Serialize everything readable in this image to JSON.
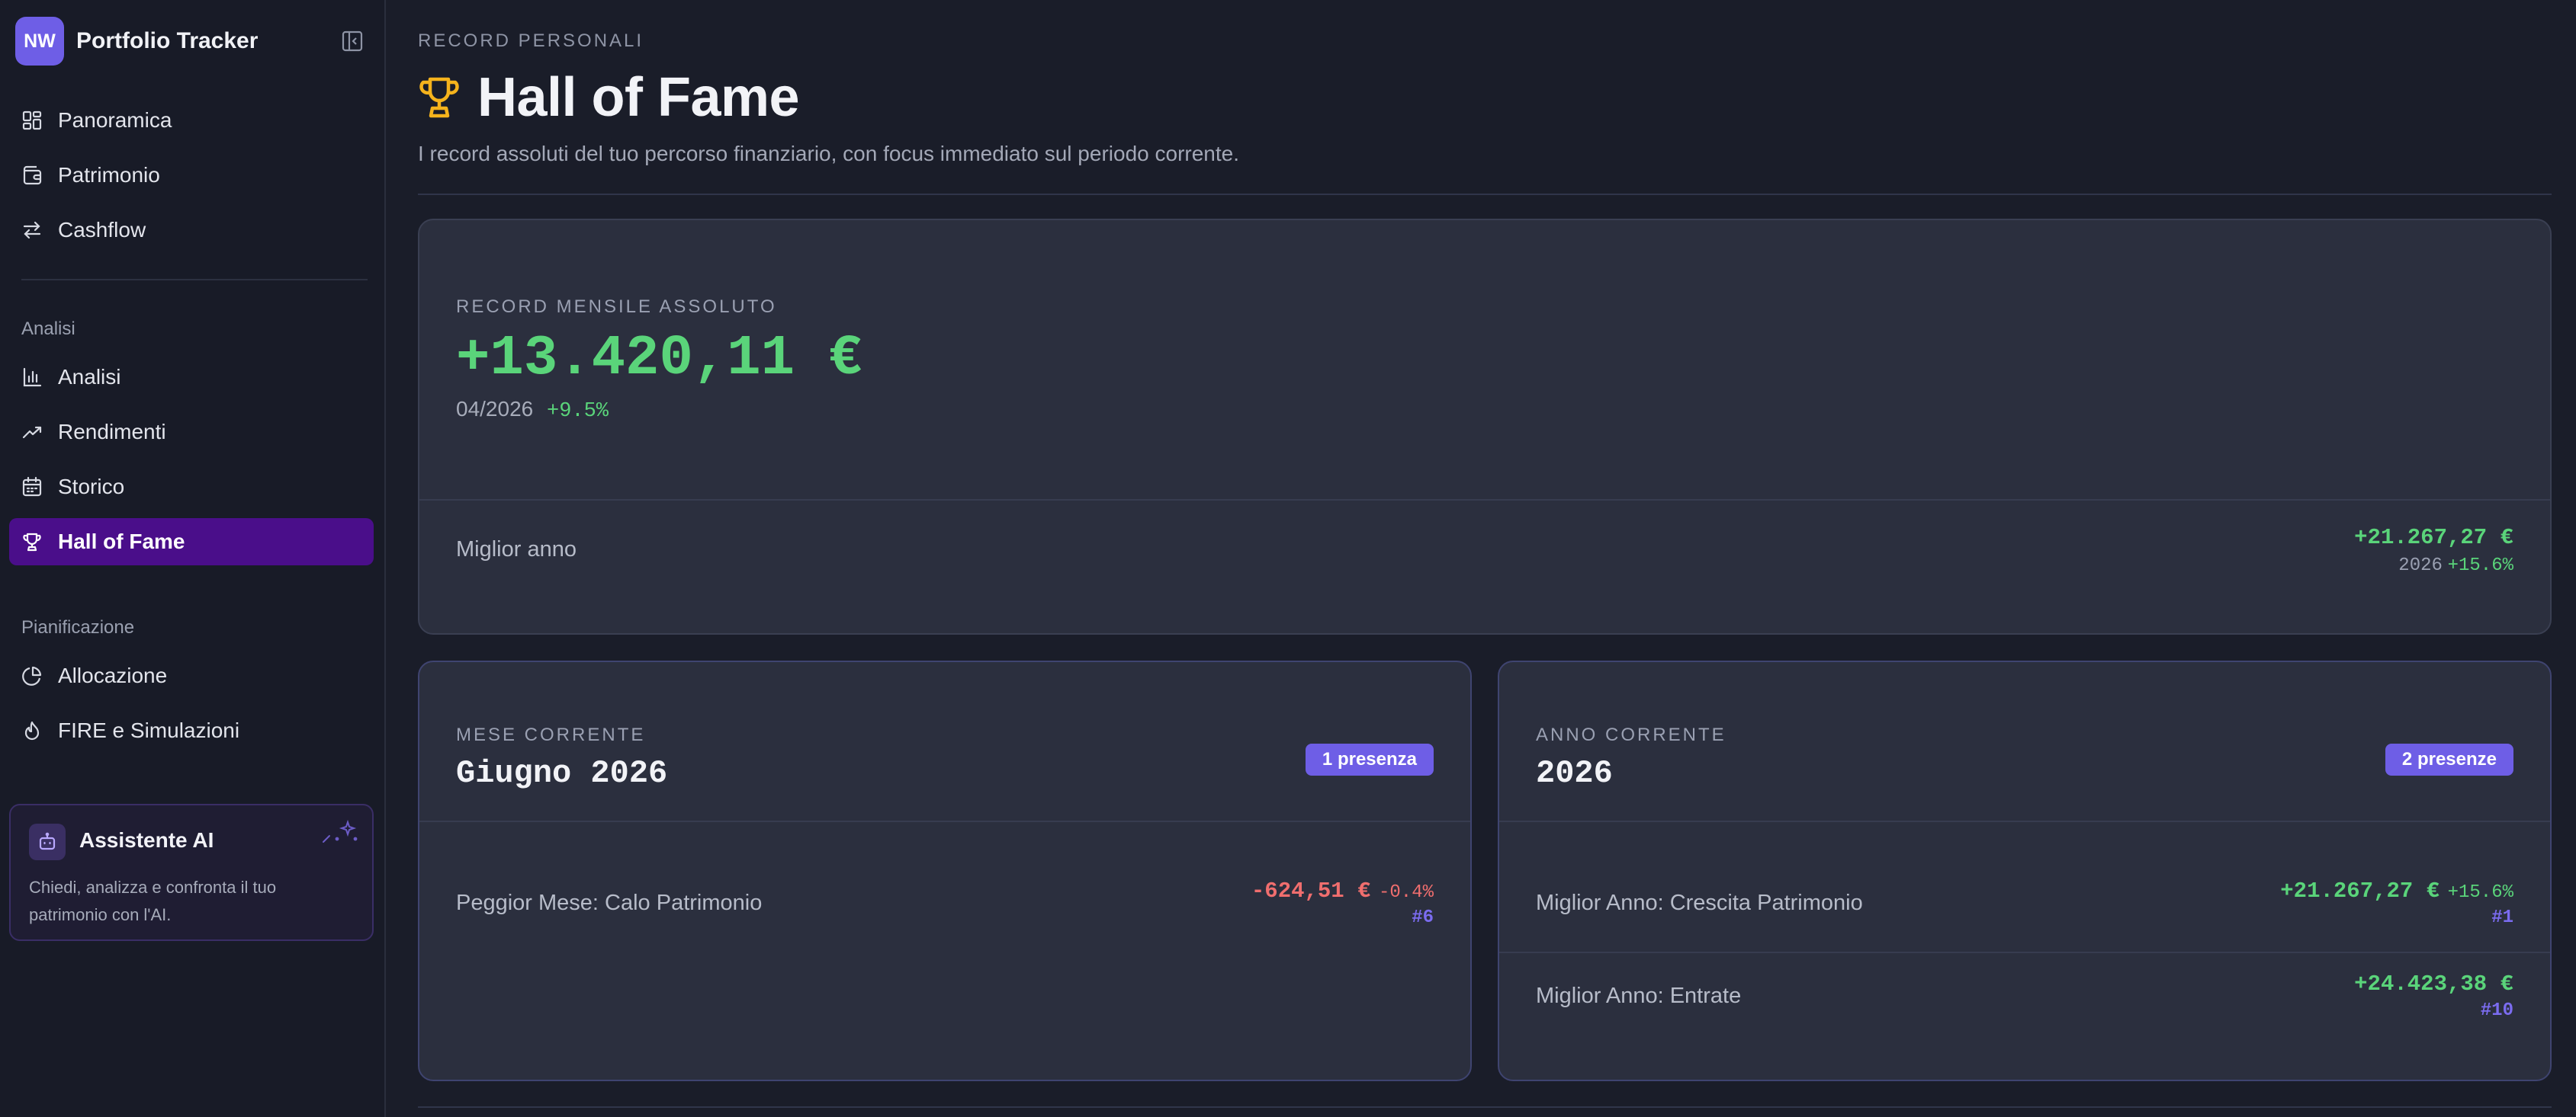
{
  "brand": {
    "initials": "NW",
    "title": "Portfolio Tracker"
  },
  "nav": {
    "main": [
      {
        "label": "Panoramica",
        "icon": "dashboard-icon"
      },
      {
        "label": "Patrimonio",
        "icon": "wallet-icon"
      },
      {
        "label": "Cashflow",
        "icon": "arrows-swap-icon"
      }
    ],
    "analysis_section": "Analisi",
    "analysis": [
      {
        "label": "Analisi",
        "icon": "bar-chart-icon"
      },
      {
        "label": "Rendimenti",
        "icon": "trend-up-icon"
      },
      {
        "label": "Storico",
        "icon": "calendar-icon"
      },
      {
        "label": "Hall of Fame",
        "icon": "trophy-icon",
        "active": true
      }
    ],
    "planning_section": "Pianificazione",
    "planning": [
      {
        "label": "Allocazione",
        "icon": "pie-chart-icon"
      },
      {
        "label": "FIRE e Simulazioni",
        "icon": "flame-icon"
      }
    ]
  },
  "ai": {
    "title": "Assistente AI",
    "description": "Chiedi, analizza e confronta il tuo patrimonio con l'AI."
  },
  "page": {
    "eyebrow": "RECORD PERSONALI",
    "title": "Hall of Fame",
    "subtitle": "I record assoluti del tuo percorso finanziario, con focus immediato sul periodo corrente."
  },
  "record": {
    "label": "RECORD MENSILE ASSOLUTO",
    "value": "+13.420,11 €",
    "period": "04/2026",
    "pct": "+9.5%",
    "best_year_label": "Miglior anno",
    "best_year_value": "+21.267,27 €",
    "best_year_year": "2026",
    "best_year_pct": "+15.6%"
  },
  "current_month": {
    "label": "MESE CORRENTE",
    "title": "Giugno 2026",
    "badge": "1 presenza",
    "rows": [
      {
        "label": "Peggior Mese: Calo Patrimonio",
        "value": "-624,51 €",
        "pct": "-0.4%",
        "rank": "#6"
      }
    ]
  },
  "current_year": {
    "label": "ANNO CORRENTE",
    "title": "2026",
    "badge": "2 presenze",
    "rows": [
      {
        "label": "Miglior Anno: Crescita Patrimonio",
        "value": "+21.267,27 €",
        "pct": "+15.6%",
        "rank": "#1"
      },
      {
        "label": "Miglior Anno: Entrate",
        "value": "+24.423,38 €",
        "pct": "",
        "rank": "#10"
      }
    ]
  },
  "colors": {
    "accent": "#6e5ee6",
    "active_nav": "#4a0e8a",
    "positive": "#5ad47a",
    "negative": "#f06e6e",
    "trophy": "#f5b31c"
  }
}
